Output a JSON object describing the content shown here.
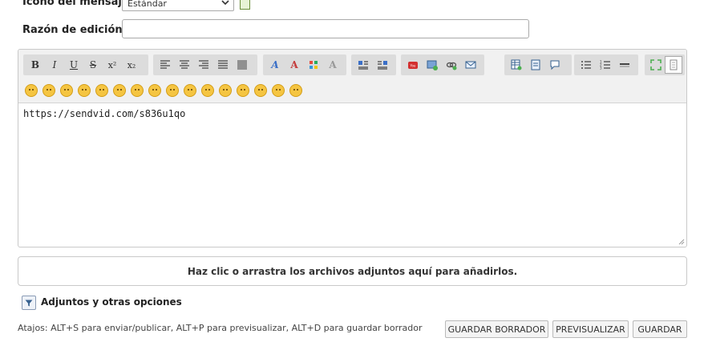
{
  "form": {
    "icon_label": "Icono del mensaje",
    "icon_select_value": "Estándar",
    "edit_reason_label": "Razón de edición",
    "edit_reason_value": ""
  },
  "toolbar": {
    "groups": [
      [
        "bold-icon",
        "italic-icon",
        "underline-icon",
        "strikethrough-icon",
        "superscript-icon",
        "subscript-icon"
      ],
      [
        "align-left-icon",
        "align-center-icon",
        "align-right-icon",
        "align-justify-icon",
        "align-full-icon"
      ],
      [
        "font-icon",
        "font-color-icon",
        "color-palette-icon",
        "clear-format-icon"
      ],
      [
        "list-left-icon",
        "list-right-icon"
      ],
      [
        "youtube-icon",
        "image-icon",
        "link-icon",
        "email-icon"
      ],
      [
        "table-icon",
        "quote-icon",
        "speech-icon"
      ],
      [
        "bullet-list-icon",
        "numbered-list-icon",
        "horizontal-rule-icon"
      ],
      [
        "fullscreen-icon",
        "source-icon"
      ]
    ],
    "text_buttons": {
      "bold": "B",
      "italic": "I",
      "underline": "U",
      "strike": "S",
      "super": "x²",
      "sub": "x₂"
    }
  },
  "smileys": [
    "smile",
    "wink",
    "grin",
    "big-grin",
    "laugh",
    "neutral",
    "eyeroll",
    "cool",
    "confused",
    "happy",
    "tongue",
    "blush",
    "surprised",
    "relieved",
    "kiss",
    "grimace"
  ],
  "editor": {
    "content": "https://sendvid.com/s836u1qo"
  },
  "dropzone": {
    "text": "Haz clic o arrastra los archivos adjuntos aquí para añadirlos."
  },
  "options": {
    "label": "Adjuntos y otras opciones"
  },
  "shortcuts": {
    "text": "Atajos: ALT+S para enviar/publicar, ALT+P para previsualizar, ALT+D para guardar borrador"
  },
  "actions": {
    "save_draft": "GUARDAR BORRADOR",
    "preview": "PREVISUALIZAR",
    "save": "GUARDAR"
  }
}
